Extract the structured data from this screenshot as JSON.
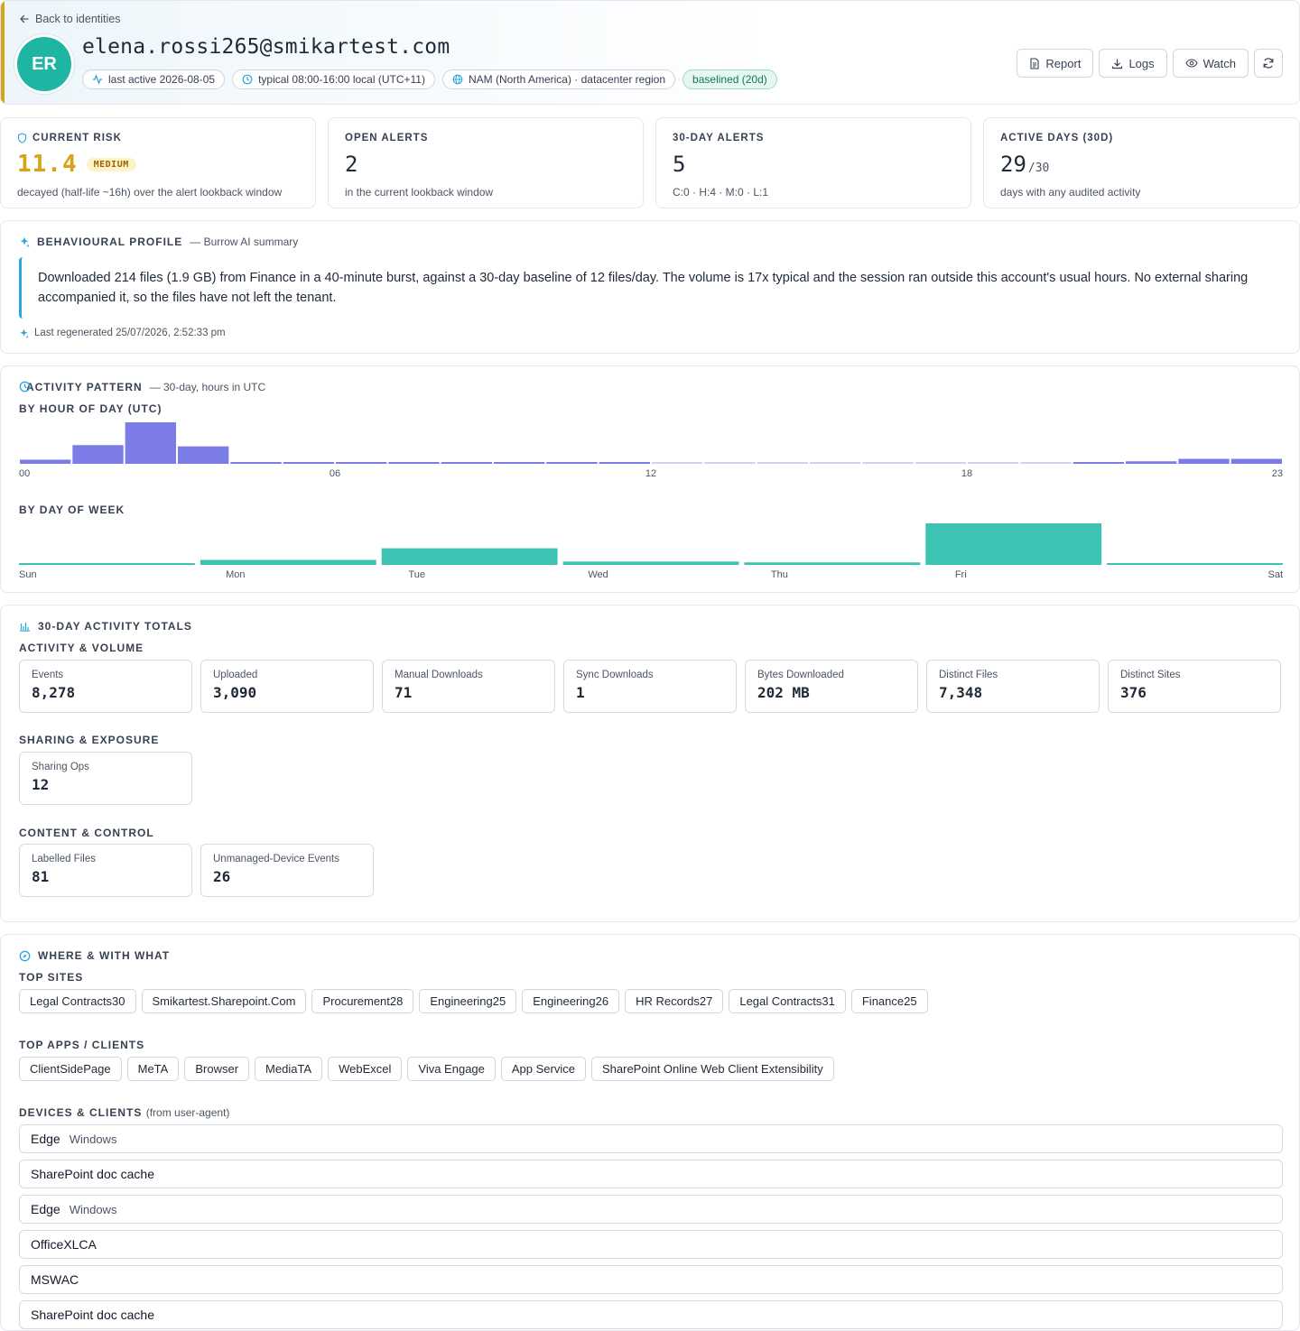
{
  "header": {
    "back_label": "Back to identities",
    "avatar_initials": "ER",
    "email": "elena.rossi265@smikartest.com",
    "chips": [
      {
        "text": "last active 2026-08-05",
        "icon": "activity-icon"
      },
      {
        "text": "typical 08:00-16:00 local (UTC+11)",
        "icon": "clock-icon"
      },
      {
        "text": "NAM (North America) · datacenter region",
        "icon": "globe-icon"
      },
      {
        "text": "baselined (20d)",
        "icon": ""
      }
    ],
    "actions": {
      "report": "Report",
      "logs": "Logs",
      "watch": "Watch"
    }
  },
  "stats": [
    {
      "title": "CURRENT RISK",
      "value": "11.4",
      "badge": "MEDIUM",
      "sub": "decayed (half-life ~16h) over the alert lookback window"
    },
    {
      "title": "OPEN ALERTS",
      "value": "2",
      "sub": "in the current lookback window"
    },
    {
      "title": "30-DAY ALERTS",
      "value": "5",
      "sub": "C:0 · H:4 · M:0 · L:1"
    },
    {
      "title": "ACTIVE DAYS (30D)",
      "value": "29",
      "denom": "/30",
      "sub": "days with any audited activity"
    }
  ],
  "behavioural": {
    "title": "BEHAVIOURAL PROFILE",
    "subtitle": "— Burrow AI summary",
    "summary": "Downloaded 214 files (1.9 GB) from Finance in a 40-minute burst, against a 30-day baseline of 12 files/day. The volume is 17x typical and the session ran outside this account's usual hours. No external sharing accompanied it, so the files have not left the tenant.",
    "regenerated": "Last regenerated 25/07/2026, 2:52:33 pm"
  },
  "activity": {
    "title": "ACTIVITY PATTERN",
    "subtitle": "— 30-day, hours in UTC",
    "hour_title": "BY HOUR OF DAY (UTC)",
    "day_title": "BY DAY OF WEEK"
  },
  "chart_data": [
    {
      "type": "bar",
      "title": "BY HOUR OF DAY (UTC)",
      "categories": [
        "00",
        "01",
        "02",
        "03",
        "04",
        "05",
        "06",
        "07",
        "08",
        "09",
        "10",
        "11",
        "12",
        "13",
        "14",
        "15",
        "16",
        "17",
        "18",
        "19",
        "20",
        "21",
        "22",
        "23"
      ],
      "tick_labels": [
        "00",
        "06",
        "12",
        "18",
        "23"
      ],
      "values": [
        10,
        45,
        100,
        42,
        3,
        3,
        3,
        3,
        3,
        3,
        3,
        3,
        1,
        1,
        1,
        1,
        1,
        1,
        1,
        1,
        3,
        6,
        12,
        12
      ],
      "color": "#7c7ce8"
    },
    {
      "type": "bar",
      "title": "BY DAY OF WEEK",
      "categories": [
        "Sun",
        "Mon",
        "Tue",
        "Wed",
        "Thu",
        "Fri",
        "Sat"
      ],
      "values": [
        4,
        12,
        40,
        8,
        6,
        100,
        4
      ],
      "color": "#3cc3b2"
    }
  ],
  "totals": {
    "title": "30-DAY ACTIVITY TOTALS",
    "groups": [
      {
        "title": "ACTIVITY & VOLUME",
        "tiles": [
          {
            "label": "Events",
            "value": "8,278"
          },
          {
            "label": "Uploaded",
            "value": "3,090"
          },
          {
            "label": "Manual Downloads",
            "value": "71"
          },
          {
            "label": "Sync Downloads",
            "value": "1"
          },
          {
            "label": "Bytes Downloaded",
            "value": "202 MB"
          },
          {
            "label": "Distinct Files",
            "value": "7,348"
          },
          {
            "label": "Distinct Sites",
            "value": "376"
          }
        ]
      },
      {
        "title": "SHARING & EXPOSURE",
        "tiles": [
          {
            "label": "Sharing Ops",
            "value": "12"
          }
        ]
      },
      {
        "title": "CONTENT & CONTROL",
        "tiles": [
          {
            "label": "Labelled Files",
            "value": "81"
          },
          {
            "label": "Unmanaged-Device Events",
            "value": "26"
          }
        ]
      }
    ]
  },
  "where": {
    "title": "WHERE & WITH WHAT",
    "sites_title": "TOP SITES",
    "sites": [
      "Legal Contracts30",
      "Smikartest.Sharepoint.Com",
      "Procurement28",
      "Engineering25",
      "Engineering26",
      "HR Records27",
      "Legal Contracts31",
      "Finance25"
    ],
    "apps_title": "TOP APPS / CLIENTS",
    "apps": [
      "ClientSidePage",
      "MeTA",
      "Browser",
      "MediaTA",
      "WebExcel",
      "Viva Engage",
      "App Service",
      "SharePoint Online Web Client Extensibility"
    ],
    "devices_title": "DEVICES & CLIENTS",
    "devices_note": "(from user-agent)",
    "devices": [
      {
        "name": "Edge",
        "os": "Windows"
      },
      {
        "name": "SharePoint doc cache",
        "os": ""
      },
      {
        "name": "Edge",
        "os": "Windows"
      },
      {
        "name": "OfficeXLCA",
        "os": ""
      },
      {
        "name": "MSWAC",
        "os": ""
      },
      {
        "name": "SharePoint doc cache",
        "os": ""
      }
    ]
  },
  "colors": {
    "accent_gold": "#d9a21b",
    "teal": "#1fb5a3",
    "indigo": "#7c7ce8",
    "bar_teal": "#3cc3b2"
  }
}
